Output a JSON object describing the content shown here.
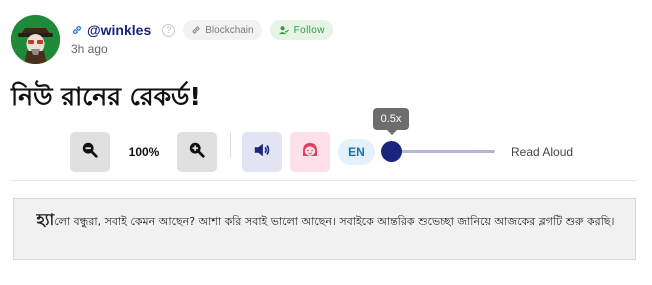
{
  "post": {
    "author": "@winkles",
    "tag": "Blockchain",
    "follow_label": "Follow",
    "time": "3h ago",
    "title": "নিউ রানের রেকর্ড!"
  },
  "toolbar": {
    "zoom_level": "100%",
    "language": "EN",
    "speed_label": "0.5x",
    "speed_value": 0.5,
    "read_aloud_label": "Read Aloud"
  },
  "quote": {
    "lead": "হ্যা",
    "body": "লো বন্ধুরা, সবাই কেমন আছেন? আশা করি সবাই ভালো আছেন। সবাইকে আন্তরিক শুভেচ্ছা জানিয়ে আজকের ব্লগটি শুরু করছি।"
  },
  "icons": {
    "avatar": "avatar-image",
    "link": "link-icon",
    "help": "help-icon",
    "tag": "link-icon",
    "follow": "user-check-icon",
    "zoom_out": "zoom-out-icon",
    "zoom_in": "zoom-in-icon",
    "speaker": "speaker-icon",
    "voice": "voice-face-icon"
  },
  "colors": {
    "username": "#1a237e",
    "follow_bg": "#e6f4e6",
    "follow_text": "#2e9e43",
    "accent": "#1a237e"
  }
}
